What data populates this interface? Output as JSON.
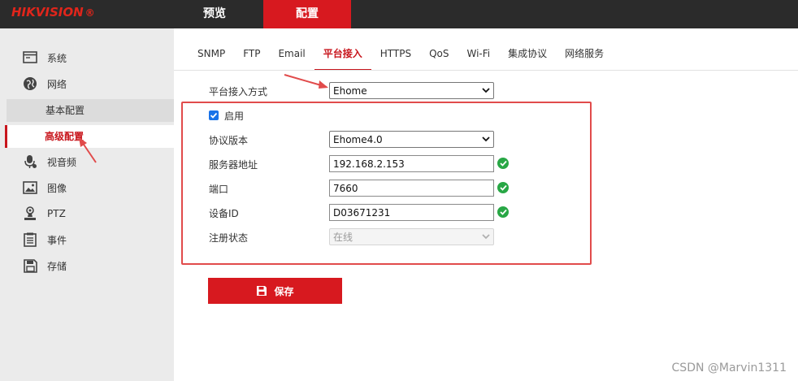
{
  "brand": {
    "logo_text": "HIKVISION",
    "logo_reg": "®",
    "accent_color": "#d7191f"
  },
  "top_nav": {
    "tabs": [
      {
        "label": "预览"
      },
      {
        "label": "配置",
        "active": true
      }
    ]
  },
  "sidebar": {
    "items": [
      {
        "label": "系统",
        "icon": "monitor-icon"
      },
      {
        "label": "网络",
        "icon": "globe-icon"
      },
      {
        "label": "视音频",
        "icon": "mic-icon"
      },
      {
        "label": "图像",
        "icon": "image-icon"
      },
      {
        "label": "PTZ",
        "icon": "ptz-icon"
      },
      {
        "label": "事件",
        "icon": "event-icon"
      },
      {
        "label": "存储",
        "icon": "storage-icon"
      }
    ],
    "sub_items": [
      {
        "label": "基本配置"
      },
      {
        "label": "高级配置",
        "active": true
      }
    ]
  },
  "sub_tabs": [
    {
      "label": "SNMP"
    },
    {
      "label": "FTP"
    },
    {
      "label": "Email"
    },
    {
      "label": "平台接入",
      "active": true
    },
    {
      "label": "HTTPS"
    },
    {
      "label": "QoS"
    },
    {
      "label": "Wi-Fi"
    },
    {
      "label": "集成协议"
    },
    {
      "label": "网络服务"
    }
  ],
  "form": {
    "access_mode_label": "平台接入方式",
    "access_mode_value": "Ehome",
    "enable_label": "启用",
    "enable_checked": true,
    "protocol_version_label": "协议版本",
    "protocol_version_value": "Ehome4.0",
    "server_address_label": "服务器地址",
    "server_address_value": "192.168.2.153",
    "port_label": "端口",
    "port_value": "7660",
    "device_id_label": "设备ID",
    "device_id_value": "D03671231",
    "register_status_label": "注册状态",
    "register_status_value": "在线"
  },
  "save_button": {
    "label": "保存"
  },
  "watermark": "CSDN @Marvin1311",
  "colors": {
    "annotation_red": "#e14b4b",
    "valid_green": "#28a745"
  }
}
